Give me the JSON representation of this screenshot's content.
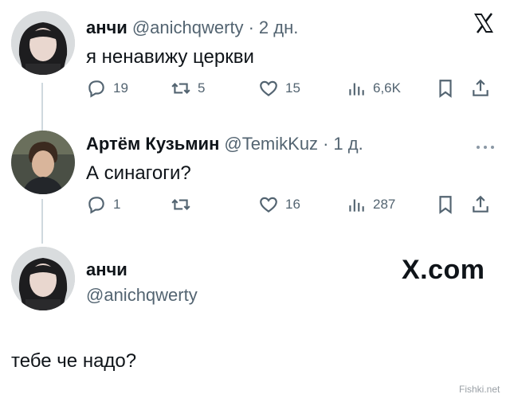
{
  "tweets": [
    {
      "author_name": "анчи",
      "handle": "@anichqwerty",
      "separator": "·",
      "time": "2 дн.",
      "text": "я ненавижу церкви",
      "stats": {
        "replies": "19",
        "retweets": "5",
        "likes": "15",
        "views": "6,6K"
      }
    },
    {
      "author_name": "Артём Кузьмин",
      "handle": "@TemikKuz",
      "separator": "·",
      "time": "1 д.",
      "text": "А синагоги?",
      "stats": {
        "replies": "1",
        "retweets": "",
        "likes": "16",
        "views": "287"
      }
    }
  ],
  "reply": {
    "author_name": "анчи",
    "handle": "@anichqwerty",
    "brand": "X.com",
    "text": "тебе че надо?"
  },
  "icons": {
    "x_logo": "x-logo-icon",
    "more": "more-icon",
    "reply": "reply-icon",
    "retweet": "retweet-icon",
    "like": "heart-icon",
    "views": "views-icon",
    "bookmark": "bookmark-icon",
    "share": "share-icon"
  },
  "watermark": "Fishki.net",
  "colors": {
    "text": "#0f1419",
    "muted": "#536471",
    "thread": "#cfd9de",
    "background": "#ffffff"
  }
}
